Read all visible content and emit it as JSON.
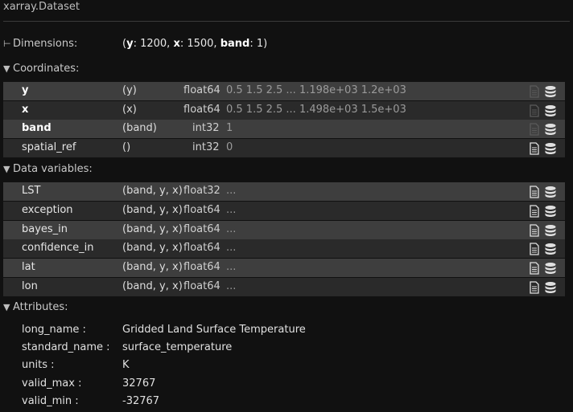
{
  "title": "xarray.Dataset",
  "dimensions": {
    "label": "Dimensions:",
    "y_name": "y",
    "y_val": ": 1200, ",
    "x_name": "x",
    "x_val": ": 1500, ",
    "band_name": "band",
    "band_val": ": 1)"
  },
  "coordinates": {
    "label": "Coordinates:",
    "rows": [
      {
        "name": "y",
        "dims": "(y)",
        "dtype": "float64",
        "preview": "0.5 1.5 2.5 ... 1.198e+03 1.2e+03"
      },
      {
        "name": "x",
        "dims": "(x)",
        "dtype": "float64",
        "preview": "0.5 1.5 2.5 ... 1.498e+03 1.5e+03"
      },
      {
        "name": "band",
        "dims": "(band)",
        "dtype": "int32",
        "preview": "1"
      },
      {
        "name": "spatial_ref",
        "dims": "()",
        "dtype": "int32",
        "preview": "0"
      }
    ]
  },
  "data_variables": {
    "label": "Data variables:",
    "rows": [
      {
        "name": "LST",
        "dims": "(band, y, x)",
        "dtype": "float32",
        "preview": "..."
      },
      {
        "name": "exception",
        "dims": "(band, y, x)",
        "dtype": "float64",
        "preview": "..."
      },
      {
        "name": "bayes_in",
        "dims": "(band, y, x)",
        "dtype": "float64",
        "preview": "..."
      },
      {
        "name": "confidence_in",
        "dims": "(band, y, x)",
        "dtype": "float64",
        "preview": "..."
      },
      {
        "name": "lat",
        "dims": "(band, y, x)",
        "dtype": "float64",
        "preview": "..."
      },
      {
        "name": "lon",
        "dims": "(band, y, x)",
        "dtype": "float64",
        "preview": "..."
      }
    ]
  },
  "attributes": {
    "label": "Attributes:",
    "items": [
      {
        "key": "long_name :",
        "value": "Gridded Land Surface Temperature"
      },
      {
        "key": "standard_name :",
        "value": "surface_temperature"
      },
      {
        "key": "units :",
        "value": "K"
      },
      {
        "key": "valid_max :",
        "value": "32767"
      },
      {
        "key": "valid_min :",
        "value": "-32767"
      }
    ]
  },
  "icons": {
    "attrs": "file-text-icon",
    "data": "database-icon"
  },
  "colors": {
    "background": "#111111",
    "row_light": "#3e3e3e",
    "row_dark": "#2a2a2a"
  }
}
